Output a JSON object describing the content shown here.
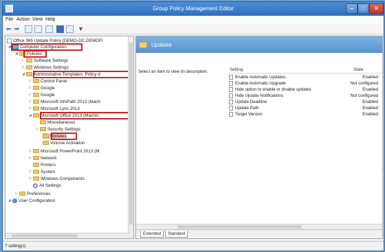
{
  "window": {
    "title": "Group Policy Management Editor"
  },
  "menu": [
    "File",
    "Action",
    "View",
    "Help"
  ],
  "tree": {
    "root": "Office 365 Update Policy [DEMO-DC.DEMOFI",
    "computer_config": "Computer Configuration",
    "policies": "Policies",
    "software_settings": "Software Settings",
    "windows_settings": "Windows Settings",
    "admin_templates": "Administrative Templates: Policy d",
    "control_panel": "Control Panel",
    "google1": "Google",
    "google2": "Google",
    "infopath": "Microsoft InfoPath 2013 (Mach",
    "lync": "Microsoft Lync 2013",
    "office2013": "Microsoft Office 2013 (Machin",
    "miscellaneous": "Miscellaneous",
    "security_settings": "Security Settings",
    "updates": "Updates",
    "volume_activation": "Volume Activation",
    "powerpoint": "Microsoft PowerPoint 2013 (M",
    "network": "Network",
    "printers": "Printers",
    "system": "System",
    "windows_components": "Windows Components",
    "all_settings": "All Settings",
    "preferences": "Preferences",
    "user_config": "User Configuration"
  },
  "right": {
    "header": "Updates",
    "description": "Select an item to view its description.",
    "col_setting": "Setting",
    "col_state": "State",
    "rows": [
      {
        "name": "Enable Automatic Updates",
        "state": "Enabled"
      },
      {
        "name": "Enable Automatic Upgrade",
        "state": "Not configured"
      },
      {
        "name": "Hide option to enable or disable updates",
        "state": "Enabled"
      },
      {
        "name": "Hide Update Notifications",
        "state": "Not configured"
      },
      {
        "name": "Update Deadline",
        "state": "Enabled"
      },
      {
        "name": "Update Path",
        "state": "Enabled"
      },
      {
        "name": "Target Version",
        "state": "Enabled"
      }
    ]
  },
  "tabs": {
    "extended": "Extended",
    "standard": "Standard"
  },
  "status": "7 setting(s)",
  "colors": {
    "highlight": "#d41f1f",
    "header": "#5593cf"
  }
}
